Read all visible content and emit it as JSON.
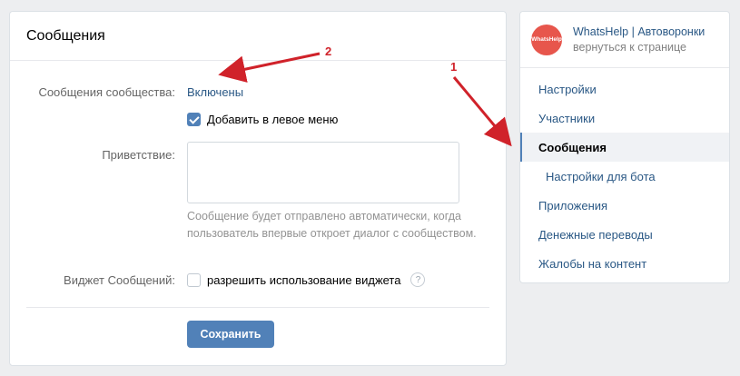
{
  "main": {
    "title": "Сообщения",
    "community_messages_label": "Сообщения сообщества:",
    "community_messages_value": "Включены",
    "add_left_menu_label": "Добавить в левое меню",
    "greeting_label": "Приветствие:",
    "greeting_value": "",
    "greeting_hint": "Сообщение будет отправлено автоматически, когда пользователь впервые откроет диалог с сообществом.",
    "widget_label": "Виджет Сообщений:",
    "widget_checkbox_label": "разрешить использование виджета",
    "help_glyph": "?",
    "save_label": "Сохранить"
  },
  "sidebar": {
    "avatar_text": "WhatsHelp",
    "group_name": "WhatsHelp | Автоворонки",
    "back_link": "вернуться к странице",
    "items": [
      {
        "label": "Настройки"
      },
      {
        "label": "Участники"
      },
      {
        "label": "Сообщения"
      },
      {
        "label": "Настройки для бота"
      },
      {
        "label": "Приложения"
      },
      {
        "label": "Денежные переводы"
      },
      {
        "label": "Жалобы на контент"
      }
    ]
  },
  "annotations": {
    "arrow1_number": "1",
    "arrow2_number": "2",
    "arrow_color": "#d0222a"
  },
  "colors": {
    "accent": "#5181b8",
    "link": "#2a5885",
    "avatar": "#e7564c"
  },
  "icons": {
    "checkbox_checked": "checkbox-checked-icon",
    "checkbox_unchecked": "checkbox-unchecked-icon",
    "help": "question-icon",
    "avatar": "whatshelp-logo"
  }
}
